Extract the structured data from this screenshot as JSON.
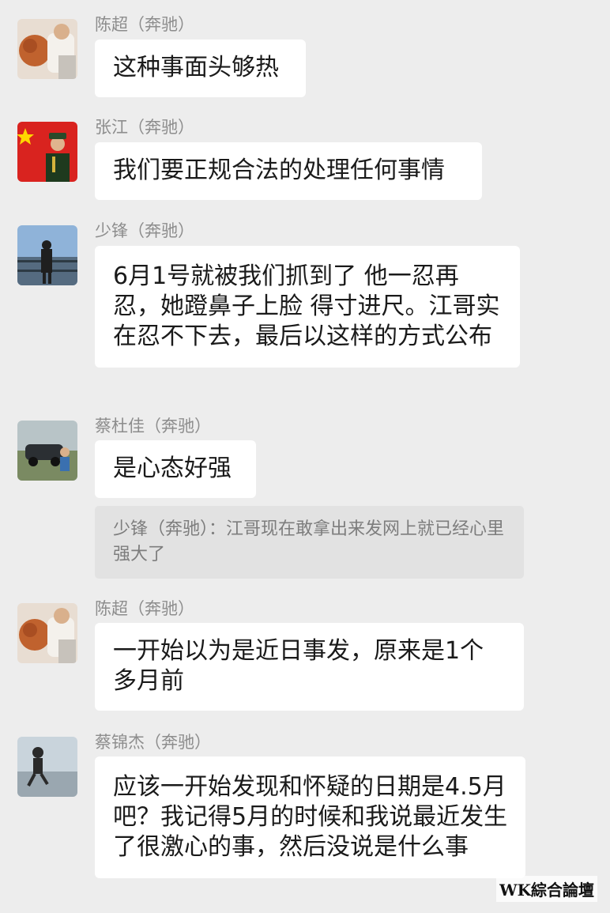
{
  "messages": [
    {
      "sender": "陈超（奔驰）",
      "avatar_icon": "person-with-dog-photo-icon",
      "text": "这种事面头够热"
    },
    {
      "sender": "张江（奔驰）",
      "avatar_icon": "soldier-with-flag-photo-icon",
      "text": "我们要正规合法的处理任何事情"
    },
    {
      "sender": "少锋（奔驰）",
      "avatar_icon": "man-on-balcony-photo-icon",
      "text": "6月1号就被我们抓到了 他一忍再忍，她蹬鼻子上脸 得寸进尺。江哥实在忍不下去，最后以这样的方式公布"
    },
    {
      "sender": "蔡杜佳（奔驰）",
      "avatar_icon": "car-outdoor-photo-icon",
      "text": "是心态好强",
      "quote": "少锋（奔驰）：江哥现在敢拿出来发网上就已经心里强大了"
    },
    {
      "sender": "陈超（奔驰）",
      "avatar_icon": "person-with-dog-photo-icon",
      "text": "一开始以为是近日事发，原来是1个多月前"
    },
    {
      "sender": "蔡锦杰（奔驰）",
      "avatar_icon": "child-running-photo-icon",
      "text": "应该一开始发现和怀疑的日期是4.5月吧？我记得5月的时候和我说最近发生了很激心的事，然后没说是什么事"
    }
  ],
  "watermark": "WK綜合論壇"
}
